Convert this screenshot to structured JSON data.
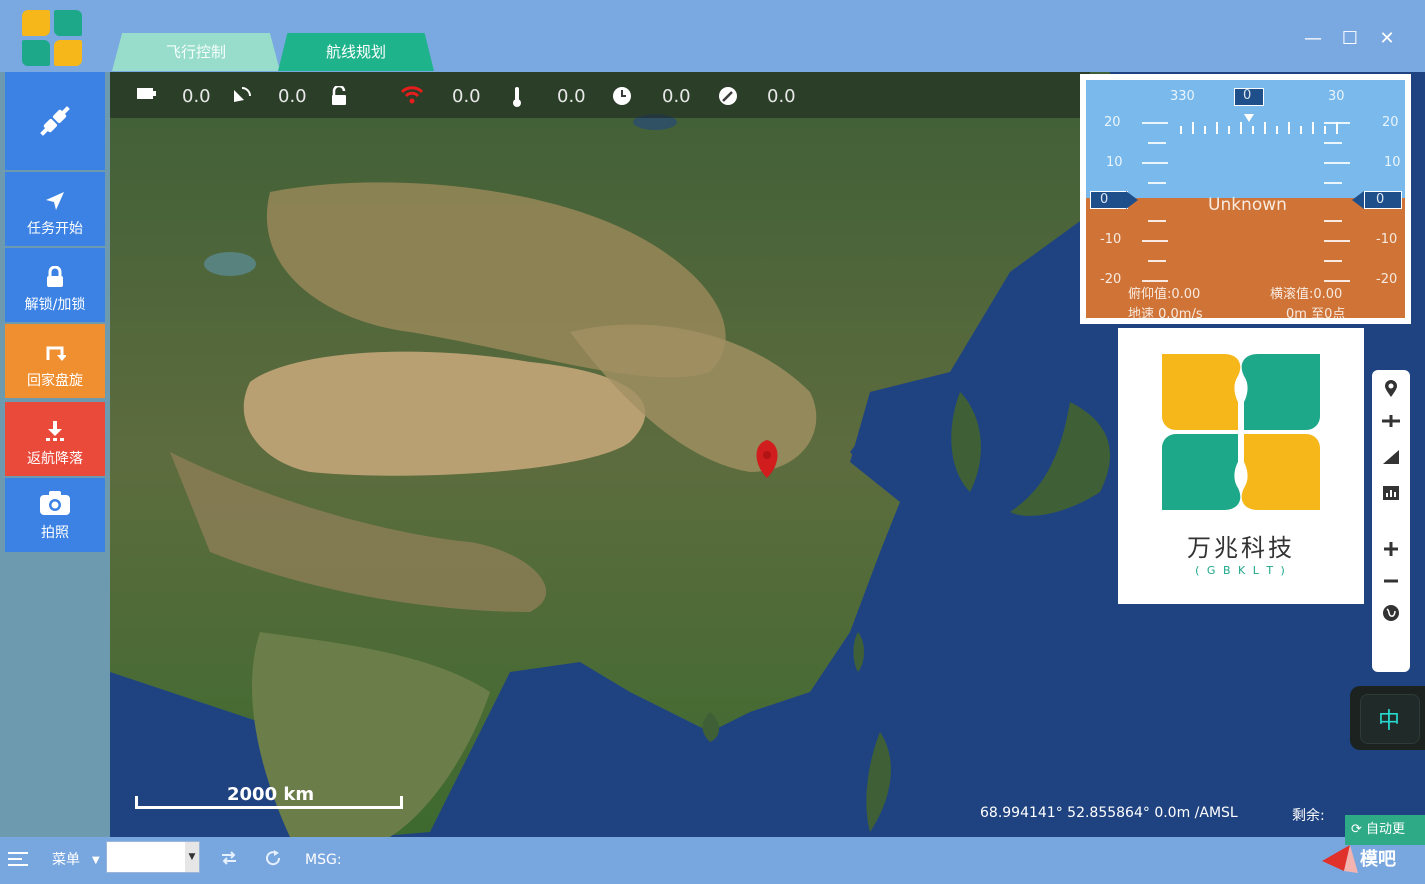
{
  "tabs": [
    {
      "label": "飞行控制"
    },
    {
      "label": "航线规划"
    }
  ],
  "window_controls": {
    "minimize": "—",
    "maximize": "☐",
    "close": "✕"
  },
  "sidebar": {
    "items": [
      {
        "label": "",
        "icon": "plug-icon"
      },
      {
        "label": "任务开始",
        "icon": "navigation-arrow-icon",
        "color": "#3b82e4"
      },
      {
        "label": "解锁/加锁",
        "icon": "lock-icon",
        "color": "#3b82e4"
      },
      {
        "label": "回家盘旋",
        "icon": "return-icon",
        "color": "#f08f2f"
      },
      {
        "label": "返航降落",
        "icon": "download-icon",
        "color": "#ea4a3a"
      },
      {
        "label": "拍照",
        "icon": "camera-icon",
        "color": "#3b82e4"
      }
    ]
  },
  "status": {
    "battery": "0.0",
    "satellite": "0.0",
    "unlock": "",
    "signal": "0.0",
    "temperature": "0.0",
    "time": "0.0",
    "speed": "0.0"
  },
  "hud": {
    "heading_left": "330",
    "heading_center": "0",
    "heading_right": "30",
    "mode": "Unknown",
    "roll_left": "0",
    "roll_right": "0",
    "pitch_labels": [
      "20",
      "10",
      "-10",
      "-20"
    ],
    "pitch_value": "俯仰值:0.00",
    "roll_value": "横滚值:0.00",
    "ground_speed": "地速 0.0m/s",
    "distance": "0m 至0点"
  },
  "brand": {
    "name": "万兆科技",
    "subtitle": "( G B K L T )"
  },
  "map": {
    "scale": "2000 km",
    "coordinates": "68.994141° 52.855864° 0.0m /AMSL",
    "remaining_label": "剩余:"
  },
  "ime": {
    "label": "中"
  },
  "bottom": {
    "menu_label": "菜单",
    "msg_label": "MSG:",
    "select_value": "",
    "auto_update": "自动更",
    "watermark": "模吧"
  }
}
